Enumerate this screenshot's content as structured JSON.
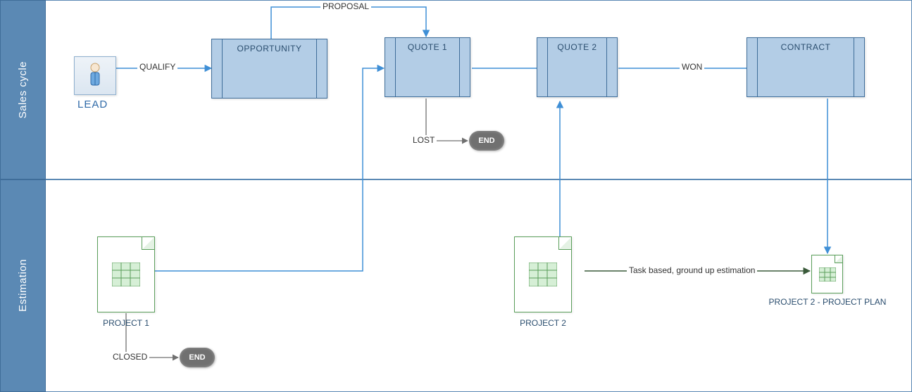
{
  "lanes": {
    "sales": "Sales cycle",
    "estimation": "Estimation"
  },
  "nodes": {
    "lead": "LEAD",
    "opportunity": "OPPORTUNITY",
    "quote1": "QUOTE 1",
    "quote2": "QUOTE 2",
    "contract": "CONTRACT",
    "project1": "PROJECT 1",
    "project2": "PROJECT 2",
    "projectplan": "PROJECT 2 - PROJECT PLAN",
    "end": "END"
  },
  "edges": {
    "qualify": "QUALIFY",
    "proposal": "PROPOSAL",
    "won": "WON",
    "lost": "LOST",
    "closed": "CLOSED",
    "taskbased": "Task based, ground up estimation"
  }
}
